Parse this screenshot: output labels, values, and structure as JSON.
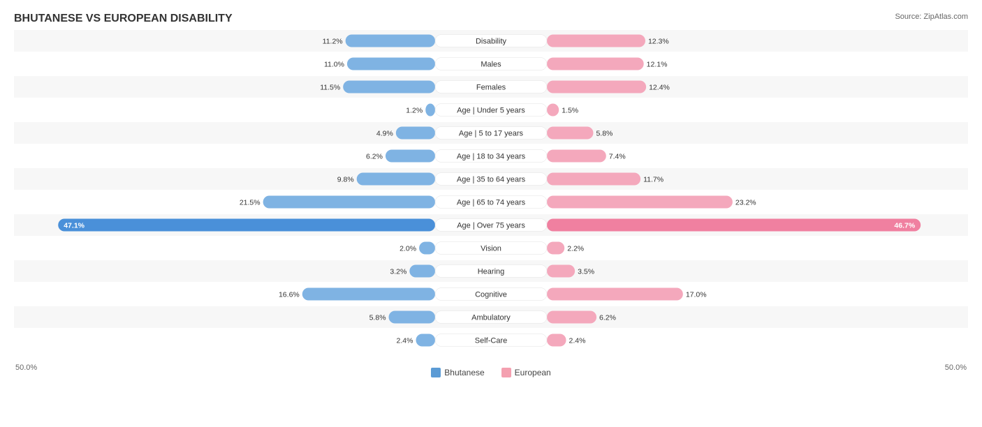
{
  "title": "BHUTANESE VS EUROPEAN DISABILITY",
  "source": "Source: ZipAtlas.com",
  "legend": {
    "bhutanese_label": "Bhutanese",
    "european_label": "European",
    "bhutanese_color": "#5b9bd5",
    "european_color": "#f4a0b0"
  },
  "axis": {
    "left": "50.0%",
    "right": "50.0%"
  },
  "rows": [
    {
      "label": "Disability",
      "blue": 11.2,
      "pink": 12.3,
      "blue_pct": "11.2%",
      "pink_pct": "12.3%"
    },
    {
      "label": "Males",
      "blue": 11.0,
      "pink": 12.1,
      "blue_pct": "11.0%",
      "pink_pct": "12.1%"
    },
    {
      "label": "Females",
      "blue": 11.5,
      "pink": 12.4,
      "blue_pct": "11.5%",
      "pink_pct": "12.4%"
    },
    {
      "label": "Age | Under 5 years",
      "blue": 1.2,
      "pink": 1.5,
      "blue_pct": "1.2%",
      "pink_pct": "1.5%"
    },
    {
      "label": "Age | 5 to 17 years",
      "blue": 4.9,
      "pink": 5.8,
      "blue_pct": "4.9%",
      "pink_pct": "5.8%"
    },
    {
      "label": "Age | 18 to 34 years",
      "blue": 6.2,
      "pink": 7.4,
      "blue_pct": "6.2%",
      "pink_pct": "7.4%"
    },
    {
      "label": "Age | 35 to 64 years",
      "blue": 9.8,
      "pink": 11.7,
      "blue_pct": "9.8%",
      "pink_pct": "11.7%"
    },
    {
      "label": "Age | 65 to 74 years",
      "blue": 21.5,
      "pink": 23.2,
      "blue_pct": "21.5%",
      "pink_pct": "23.2%"
    },
    {
      "label": "Age | Over 75 years",
      "blue": 47.1,
      "pink": 46.7,
      "blue_pct": "47.1%",
      "pink_pct": "46.7%",
      "highlight": true
    },
    {
      "label": "Vision",
      "blue": 2.0,
      "pink": 2.2,
      "blue_pct": "2.0%",
      "pink_pct": "2.2%"
    },
    {
      "label": "Hearing",
      "blue": 3.2,
      "pink": 3.5,
      "blue_pct": "3.2%",
      "pink_pct": "3.5%"
    },
    {
      "label": "Cognitive",
      "blue": 16.6,
      "pink": 17.0,
      "blue_pct": "16.6%",
      "pink_pct": "17.0%"
    },
    {
      "label": "Ambulatory",
      "blue": 5.8,
      "pink": 6.2,
      "blue_pct": "5.8%",
      "pink_pct": "6.2%"
    },
    {
      "label": "Self-Care",
      "blue": 2.4,
      "pink": 2.4,
      "blue_pct": "2.4%",
      "pink_pct": "2.4%"
    }
  ]
}
